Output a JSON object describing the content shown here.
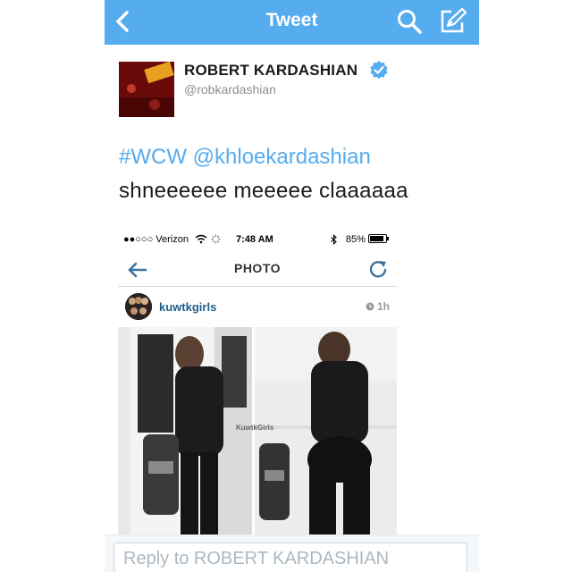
{
  "header": {
    "title": "Tweet",
    "back_icon": "chevron-left-icon",
    "search_icon": "search-icon",
    "compose_icon": "compose-icon",
    "background": "#55acee"
  },
  "tweet": {
    "author_name": "ROBERT KARDASHIAN",
    "handle": "@robkardashian",
    "verified": true,
    "text_line1": "#WCW @khloekardashian",
    "text_line2": "shneeeeee meeeee claaaaaa"
  },
  "embedded_screenshot": {
    "status": {
      "carrier": "●●○○○ Verizon",
      "time": "7:48 AM",
      "battery": "85%"
    },
    "nav_title": "PHOTO",
    "post": {
      "username": "kuwtkgirls",
      "time_ago": "1h",
      "watermark": "KuwtkGirls"
    }
  },
  "reply": {
    "placeholder": "Reply to ROBERT KARDASHIAN"
  }
}
